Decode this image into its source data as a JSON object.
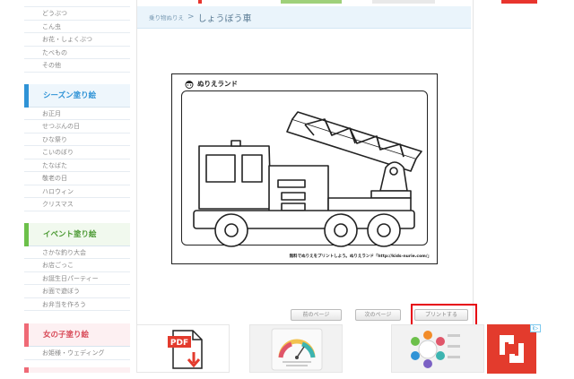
{
  "sidebar": {
    "top_items": [
      "どうぶつ",
      "こん虫",
      "お花・しょくぶつ",
      "たべもの",
      "その他"
    ],
    "sections": [
      {
        "title": "シーズン塗り絵",
        "items": [
          "お正月",
          "せつぶんの日",
          "ひな祭り",
          "こいのぼり",
          "たなばた",
          "敬老の日",
          "ハロウィン",
          "クリスマス"
        ]
      },
      {
        "title": "イベント塗り絵",
        "items": [
          "さかな釣り大会",
          "お店ごっこ",
          "お誕生日パーティー",
          "お面で遊ぼう",
          "お弁当を作ろう"
        ]
      },
      {
        "title": "女の子塗り絵",
        "items": [
          "お姫様・ウェディング"
        ]
      }
    ]
  },
  "main": {
    "breadcrumb": "乗り物ぬりえ",
    "breadcrumb_sep": ">",
    "title": "しょうぼう車",
    "preview": {
      "logo": "ぬりえランド",
      "credit": "無料でぬりえをプリントしよう。ぬりえランド「http://kids-nurie.com/」"
    },
    "buttons": {
      "prev": "前のページ",
      "next": "次のページ",
      "print": "プリントする"
    }
  },
  "ads": {
    "tile1_label": "PDF",
    "badge": "i▷"
  },
  "colors": {
    "accent_blue": "#2f93d6",
    "accent_green": "#6cc04a",
    "accent_red": "#ef6a76",
    "highlight": "#e60012"
  }
}
